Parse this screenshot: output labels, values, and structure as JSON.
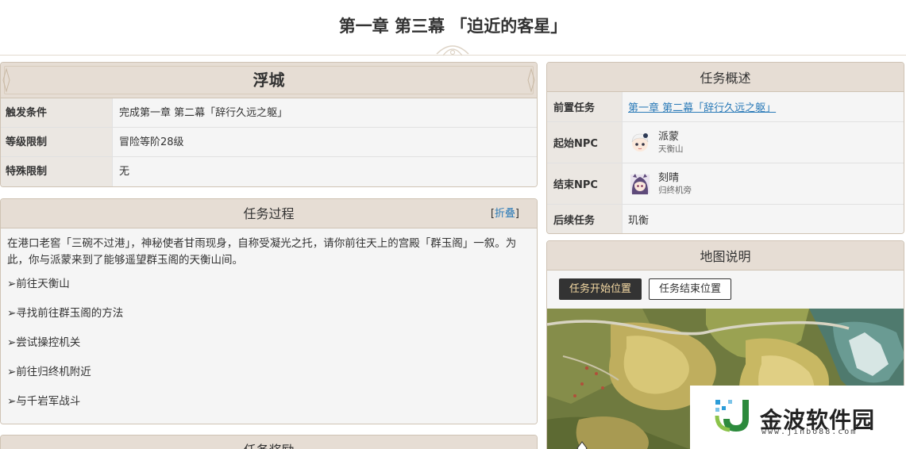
{
  "title": "第一章 第三幕 「迫近的客星」",
  "floating_city": {
    "heading": "浮城",
    "rows": [
      {
        "key": "触发条件",
        "value": "完成第一章 第二幕「辞行久远之躯」"
      },
      {
        "key": "等级限制",
        "value": "冒险等阶28级"
      },
      {
        "key": "特殊限制",
        "value": "无"
      }
    ]
  },
  "process": {
    "heading": "任务过程",
    "fold_open": "[",
    "fold_label": "折叠",
    "fold_close": "]",
    "intro": "在港口老窖「三碗不过港」，神秘使者甘雨现身，自称受凝光之托，请你前往天上的宫殿「群玉阁」一叙。为此，你与派蒙来到了能够遥望群玉阁的天衡山间。",
    "steps": [
      "➢前往天衡山",
      "➢寻找前往群玉阁的方法",
      "➢尝试操控机关",
      "➢前往归终机附近",
      "➢与千岩军战斗"
    ]
  },
  "reward": {
    "heading": "任务奖励"
  },
  "overview": {
    "heading": "任务概述",
    "prev_key": "前置任务",
    "prev_value": "第一章 第二幕「辞行久远之躯」",
    "start_key": "起始NPC",
    "start_npc": {
      "name": "派蒙",
      "location": "天衡山"
    },
    "end_key": "结束NPC",
    "end_npc": {
      "name": "刻晴",
      "location": "归终机旁"
    },
    "next_key": "后续任务",
    "next_value": "玑衡"
  },
  "map": {
    "heading": "地图说明",
    "tabs": [
      "任务开始位置",
      "任务结束位置"
    ],
    "active_tab": 0
  },
  "watermark": {
    "text": "金波软件园",
    "url": "www.jinbo88.com"
  },
  "colors": {
    "panel_head": "#e6ddd4",
    "link": "#2a7ab8",
    "active_tab_bg": "#333333",
    "active_tab_text": "#f4d9a3"
  }
}
